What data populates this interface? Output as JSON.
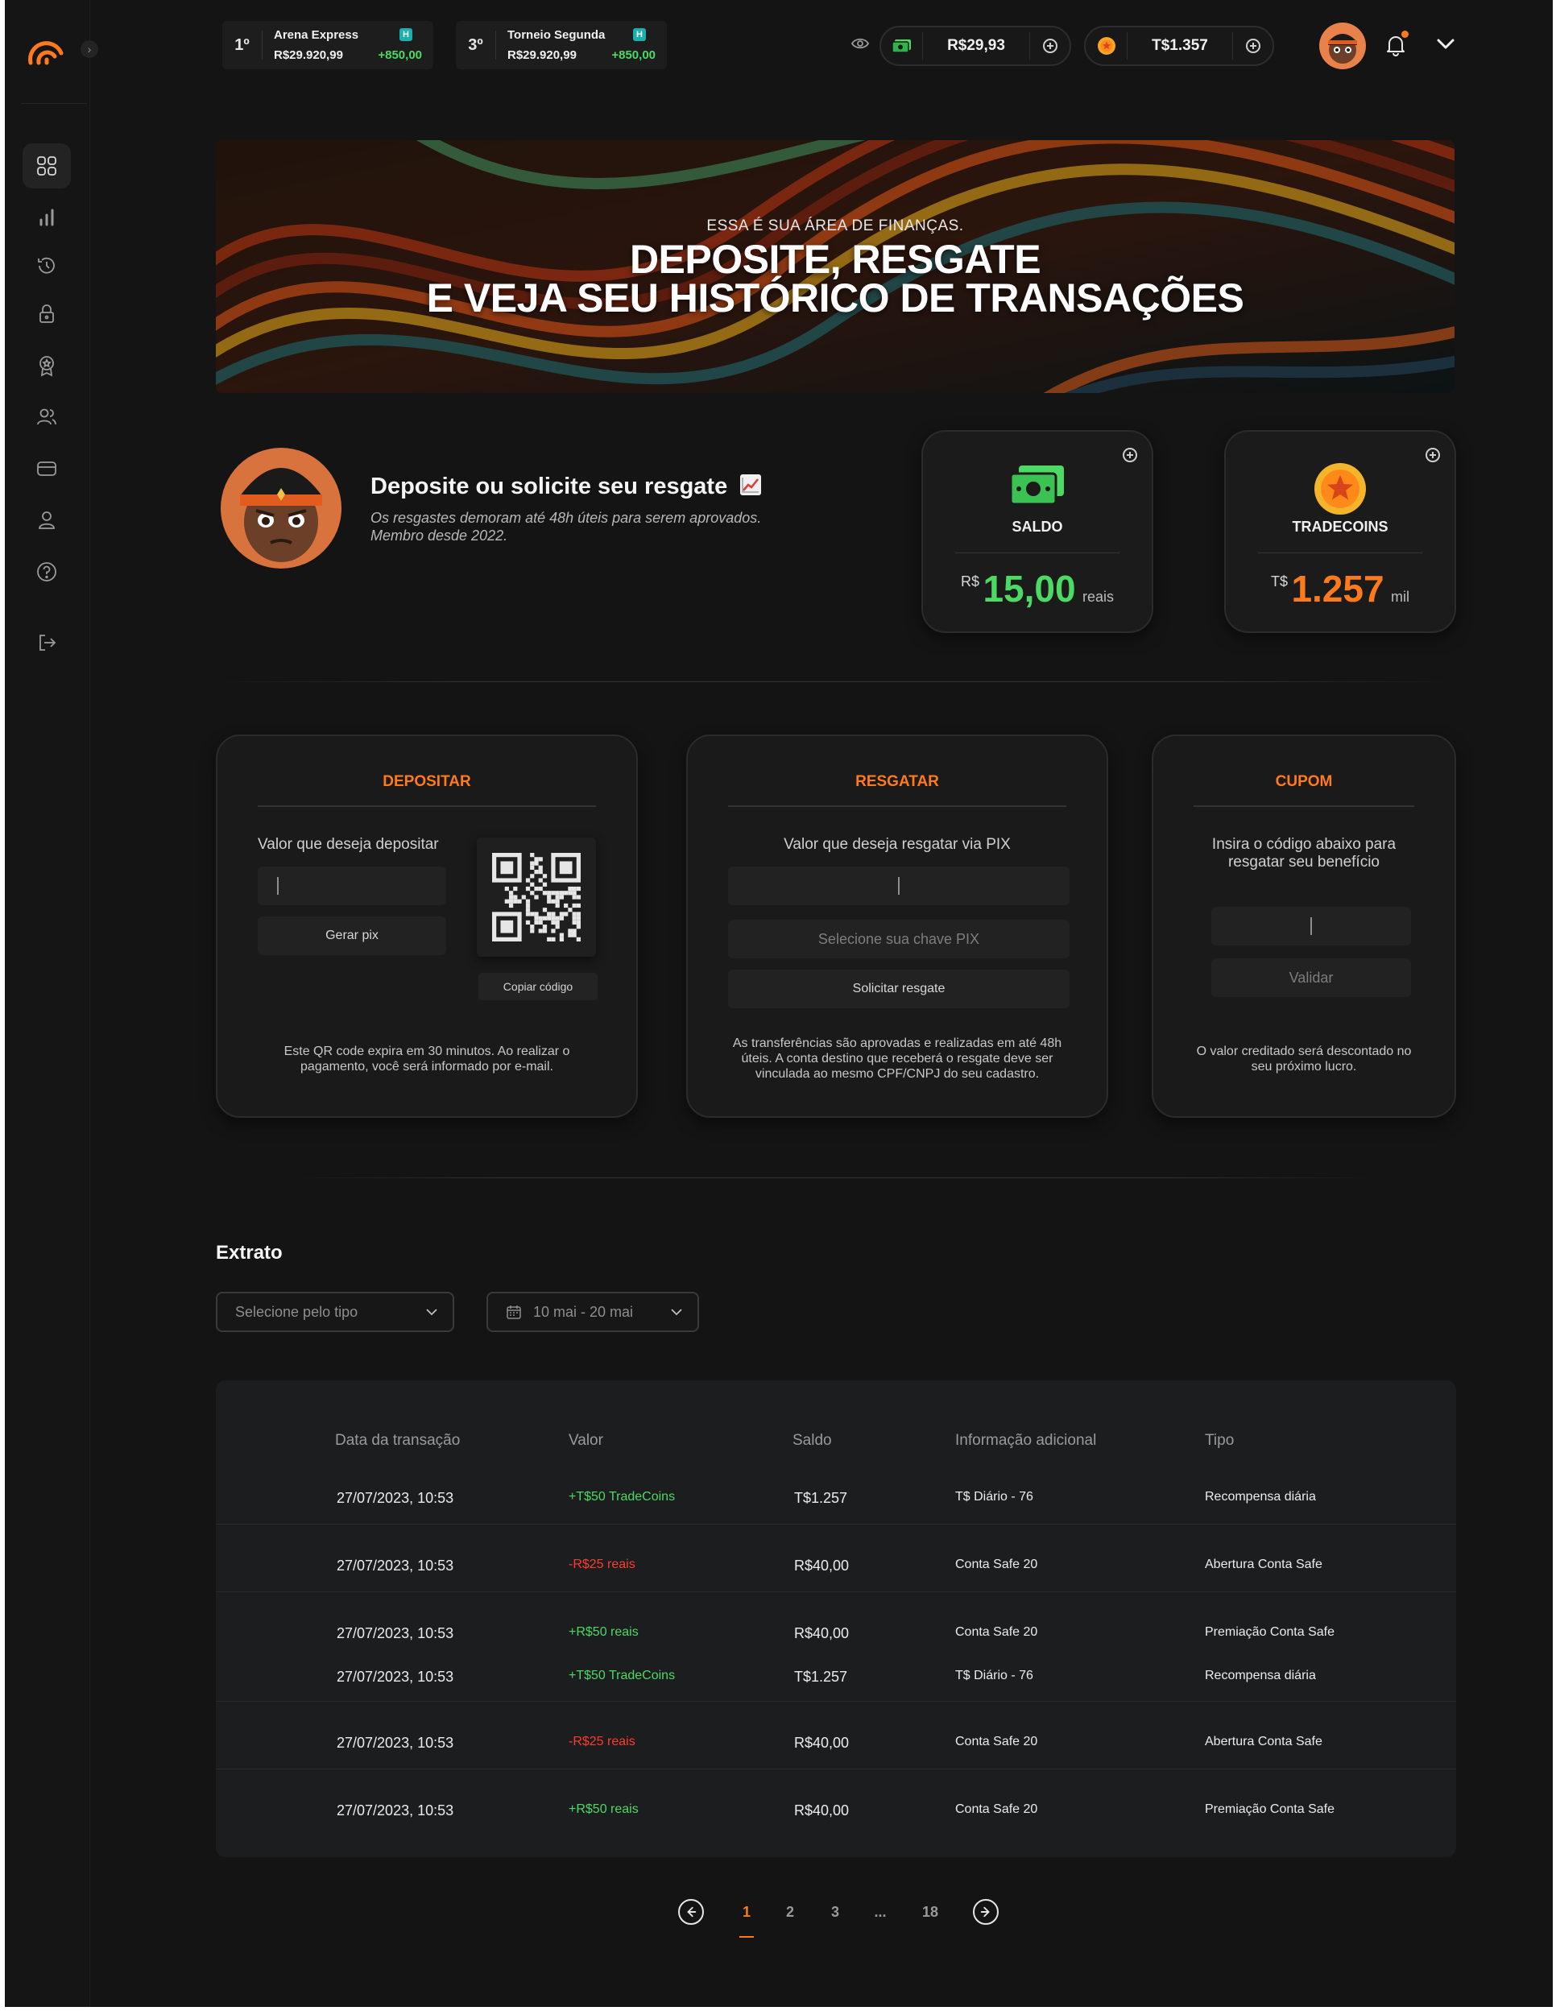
{
  "topbar": {
    "rankings": [
      {
        "position": "1º",
        "name": "Arena Express",
        "value": "R$29.920,99",
        "delta": "+850,00",
        "badge": "H"
      },
      {
        "position": "3º",
        "name": "Torneio Segunda",
        "value": "R$29.920,99",
        "delta": "+850,00",
        "badge": "H"
      }
    ],
    "balance_reais": "R$29,93",
    "balance_tradecoins": "T$1.357"
  },
  "hero": {
    "eyebrow": "ESSA É SUA ÁREA DE FINANÇAS.",
    "title_line1": "DEPOSITE, RESGATE",
    "title_line2": "E VEJA SEU HISTÓRICO DE TRANSAÇÕES"
  },
  "profile": {
    "title": "Deposite ou solicite seu resgate",
    "subtitle_line1": "Os resgastes demoram até 48h úteis para serem aprovados.",
    "subtitle_line2": "Membro desde 2022."
  },
  "balance_cards": {
    "saldo": {
      "label": "SALDO",
      "currency": "R$",
      "amount": "15,00",
      "unit": "reais",
      "color": "#4cd964"
    },
    "tradecoins": {
      "label": "TRADECOINS",
      "currency": "T$",
      "amount": "1.257",
      "unit": "mil",
      "color": "#ff7a1a"
    }
  },
  "deposit": {
    "title": "DEPOSITAR",
    "label": "Valor que deseja depositar",
    "button": "Gerar pix",
    "copy_button": "Copiar código",
    "footer": "Este QR code expira em 30 minutos. Ao realizar o pagamento, você será informado por e-mail."
  },
  "withdraw": {
    "title": "RESGATAR",
    "label": "Valor que deseja resgatar via PIX",
    "select_placeholder": "Selecione sua chave PIX",
    "button": "Solicitar resgate",
    "footer": "As transferências são aprovadas e realizadas em até 48h úteis. A conta destino que receberá o resgate deve ser vinculada ao mesmo CPF/CNPJ do seu cadastro."
  },
  "coupon": {
    "title": "CUPOM",
    "label": "Insira o código abaixo para resgatar seu benefício",
    "button": "Validar",
    "footer": "O valor creditado será descontado no seu próximo lucro."
  },
  "extrato": {
    "title": "Extrato",
    "filter_type": "Selecione pelo tipo",
    "filter_date": "10 mai - 20 mai",
    "columns": [
      "Data da transação",
      "Valor",
      "Saldo",
      "Informação adicional",
      "Tipo"
    ],
    "rows": [
      {
        "date": "27/07/2023, 10:53",
        "value": "+T$50 TradeCoins",
        "sign": "pos",
        "balance": "T$1.257",
        "info": "T$ Diário - 76",
        "type": "Recompensa diária"
      },
      {
        "date": "27/07/2023, 10:53",
        "value": "-R$25 reais",
        "sign": "neg",
        "balance": "R$40,00",
        "info": "Conta Safe 20",
        "type": "Abertura Conta Safe"
      },
      {
        "date": "27/07/2023, 10:53",
        "value": "+R$50 reais",
        "sign": "pos",
        "balance": "R$40,00",
        "info": "Conta Safe 20",
        "type": "Premiação Conta Safe"
      },
      {
        "date": "27/07/2023, 10:53",
        "value": "+T$50 TradeCoins",
        "sign": "pos",
        "balance": "T$1.257",
        "info": "T$ Diário - 76",
        "type": "Recompensa diária"
      },
      {
        "date": "27/07/2023, 10:53",
        "value": "-R$25 reais",
        "sign": "neg",
        "balance": "R$40,00",
        "info": "Conta Safe 20",
        "type": "Abertura Conta Safe"
      },
      {
        "date": "27/07/2023, 10:53",
        "value": "+R$50 reais",
        "sign": "pos",
        "balance": "R$40,00",
        "info": "Conta Safe 20",
        "type": "Premiação Conta Safe"
      }
    ]
  },
  "pagination": {
    "pages": [
      "1",
      "2",
      "3",
      "...",
      "18"
    ],
    "current": "1"
  },
  "sidebar": {
    "items": [
      "dashboard-icon",
      "chart-icon",
      "history-icon",
      "lock-icon",
      "badge-icon",
      "users-icon",
      "wallet-icon",
      "user-icon",
      "help-icon",
      "logout-icon"
    ]
  },
  "colors": {
    "accent": "#ff7a1a",
    "positive": "#4cd964",
    "negative": "#ff3b30",
    "background": "#141414"
  }
}
